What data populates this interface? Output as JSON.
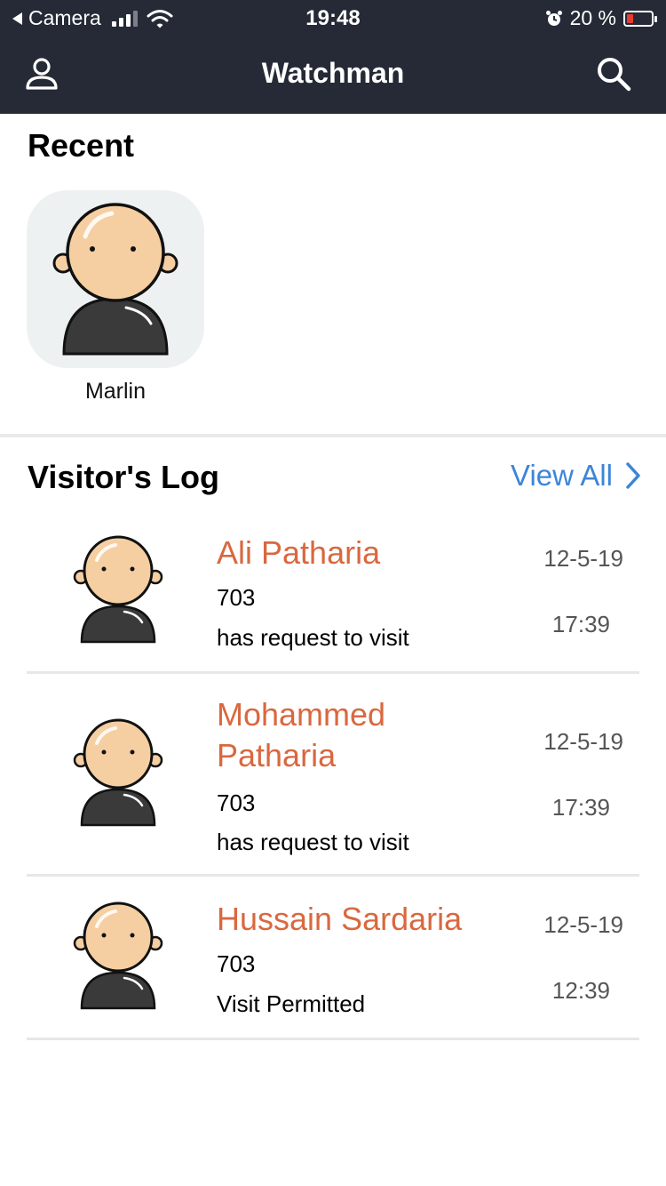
{
  "status_bar": {
    "back_app": "Camera",
    "time": "19:48",
    "battery": "20 %"
  },
  "header": {
    "title": "Watchman",
    "left_icon": "user-icon",
    "right_icon": "search-icon"
  },
  "recent": {
    "title": "Recent",
    "items": [
      {
        "name": "Marlin"
      }
    ]
  },
  "visitors_log": {
    "title": "Visitor's Log",
    "view_all_label": "View All",
    "entries": [
      {
        "name": "Ali Patharia",
        "unit": "703",
        "status": "has request to visit",
        "date": "12-5-19",
        "time": "17:39"
      },
      {
        "name": "Mohammed Patharia",
        "unit": "703",
        "status": "has request to visit",
        "date": "12-5-19",
        "time": "17:39"
      },
      {
        "name": "Hussain Sardaria",
        "unit": "703",
        "status": "Visit Permitted",
        "date": "12-5-19",
        "time": "12:39"
      }
    ]
  },
  "colors": {
    "header_bg": "#252a36",
    "visitor_name": "#d9683f",
    "link": "#3d85d8",
    "battery_low": "#e53e2f"
  }
}
